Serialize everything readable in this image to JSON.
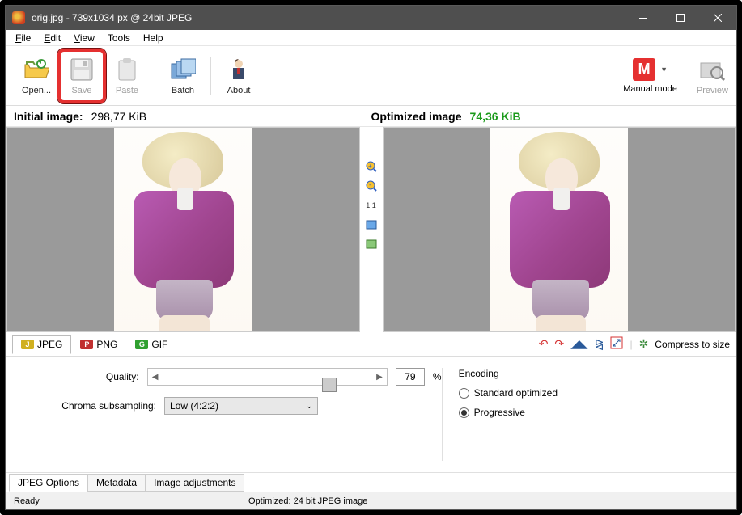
{
  "window": {
    "title": "orig.jpg - 739x1034 px @ 24bit JPEG"
  },
  "menu": {
    "file": "File",
    "edit": "Edit",
    "view": "View",
    "tools": "Tools",
    "help": "Help"
  },
  "toolbar": {
    "open": "Open...",
    "save": "Save",
    "paste": "Paste",
    "batch": "Batch",
    "about": "About",
    "mode": "Manual mode",
    "mode_icon": "M",
    "preview": "Preview"
  },
  "info": {
    "initial_label": "Initial image:",
    "initial_size": "298,77 KiB",
    "optimized_label": "Optimized image",
    "optimized_size": "74,36 KiB"
  },
  "zoom": {
    "ratio": "1:1"
  },
  "formats": {
    "jpeg": "JPEG",
    "png": "PNG",
    "gif": "GIF"
  },
  "actions": {
    "compress": "Compress to size"
  },
  "options": {
    "quality_label": "Quality:",
    "quality_value": "79",
    "percent": "%",
    "chroma_label": "Chroma subsampling:",
    "chroma_value": "Low (4:2:2)",
    "encoding_label": "Encoding",
    "standard": "Standard optimized",
    "progressive": "Progressive"
  },
  "bottom_tabs": {
    "jpeg_options": "JPEG Options",
    "metadata": "Metadata",
    "image_adj": "Image adjustments"
  },
  "status": {
    "ready": "Ready",
    "optimized": "Optimized: 24 bit JPEG image"
  }
}
